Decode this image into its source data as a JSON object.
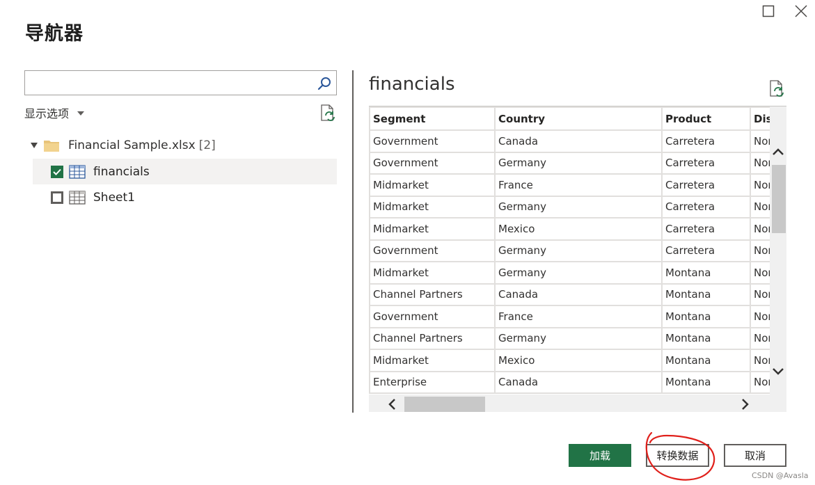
{
  "title": "导航器",
  "window_controls": {
    "maximize_icon": "maximize-icon",
    "close_icon": "close-icon"
  },
  "left_panel": {
    "search": {
      "value": "",
      "placeholder": "",
      "icon": "search-icon"
    },
    "display_options_label": "显示选项",
    "file": {
      "name": "Financial Sample.xlsx",
      "count": "[2]"
    },
    "items": [
      {
        "label": "financials",
        "checked": true,
        "selected": true
      },
      {
        "label": "Sheet1",
        "checked": false,
        "selected": false
      }
    ]
  },
  "preview": {
    "title": "financials",
    "columns": [
      "Segment",
      "Country",
      "Product",
      "Discou"
    ],
    "rows": [
      [
        "Government",
        "Canada",
        "Carretera",
        "Non"
      ],
      [
        "Government",
        "Germany",
        "Carretera",
        "Non"
      ],
      [
        "Midmarket",
        "France",
        "Carretera",
        "Non"
      ],
      [
        "Midmarket",
        "Germany",
        "Carretera",
        "Non"
      ],
      [
        "Midmarket",
        "Mexico",
        "Carretera",
        "Non"
      ],
      [
        "Government",
        "Germany",
        "Carretera",
        "Non"
      ],
      [
        "Midmarket",
        "Germany",
        "Montana",
        "Non"
      ],
      [
        "Channel Partners",
        "Canada",
        "Montana",
        "Non"
      ],
      [
        "Government",
        "France",
        "Montana",
        "Non"
      ],
      [
        "Channel Partners",
        "Germany",
        "Montana",
        "Non"
      ],
      [
        "Midmarket",
        "Mexico",
        "Montana",
        "Non"
      ],
      [
        "Enterprise",
        "Canada",
        "Montana",
        "Non"
      ]
    ]
  },
  "buttons": {
    "load": "加载",
    "transform": "转换数据",
    "cancel": "取消"
  },
  "colors": {
    "accent": "#217346",
    "annotation": "#e0201b"
  },
  "watermark": "CSDN @Avasla"
}
